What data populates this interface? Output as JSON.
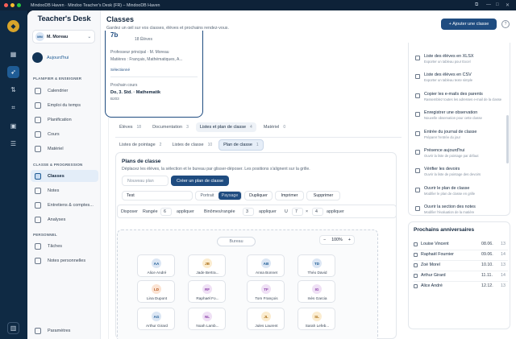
{
  "window": {
    "title": "MindooDB Haven  ·  Mindoo Teacher's Desk (FR) – MindooDB Haven"
  },
  "brand": {
    "name": "Teacher's Desk"
  },
  "user": {
    "initials": "MM",
    "name": "M. Moreau"
  },
  "sidebar": {
    "today": "Aujourd'hui",
    "section1": "PLANIFIER & ENSEIGNER",
    "plan_items": [
      "Calendrier",
      "Emploi du temps",
      "Planification",
      "Cours",
      "Matériel"
    ],
    "section2": "CLASSE & PROGRESSION",
    "class_items": [
      "Classes",
      "Notes",
      "Entretiens & comptes...",
      "Analyses"
    ],
    "section3": "PERSONNEL",
    "personal_items": [
      "Tâches",
      "Notes personnelles"
    ],
    "settings": "Paramètres"
  },
  "header": {
    "title": "Classes",
    "subtitle": "Gardez un œil sur vos classes, élèves et prochains rendez-vous.",
    "add_button": "+ Ajouter une classe",
    "help": "?"
  },
  "class_card": {
    "badge": "7b",
    "students": "18 Élèves",
    "teacher": "Professeur principal · M. Moreau",
    "subjects": "Matières : Français, Mathématiques, A...",
    "selected": "Sélectionné",
    "next_label": "Prochain cours",
    "next_value": "Do, 3. Std. · Mathematik",
    "room": "B203"
  },
  "tabs": [
    {
      "label": "Élèves",
      "count": "18"
    },
    {
      "label": "Documentation",
      "count": "3"
    },
    {
      "label": "Listes et plan de classe",
      "count": "4"
    },
    {
      "label": "Matériel",
      "count": "0"
    }
  ],
  "subtabs": [
    {
      "label": "Listes de pointage",
      "count": "2"
    },
    {
      "label": "Listes de classe",
      "count": "10"
    },
    {
      "label": "Plan de classe",
      "count": "1"
    }
  ],
  "plan": {
    "title": "Plans de classe",
    "subtitle": "Déplacez les élèves, la sélection et le bureau par glisser-déposer. Les positions s'alignent sur la grille.",
    "new_placeholder": "Nouveau plan",
    "create_button": "Créer un plan de classe",
    "name_value": "Test",
    "orientation": [
      "Portrait",
      "Paysage"
    ],
    "actions": [
      "Dupliquer",
      "Imprimer",
      "Supprimer"
    ],
    "layout": {
      "disposer": "Disposer",
      "rangee_label": "Rangée",
      "rangee_value": "6",
      "apply1": "appliquer",
      "binomes_label": "Binômes/rangée",
      "binomes_value": "3",
      "apply2": "appliquer",
      "u_label": "U",
      "u_a": "7",
      "x": "×",
      "u_b": "4",
      "apply3": "appliquer"
    },
    "bureau": "Bureau",
    "zoom": {
      "minus": "−",
      "value": "100%",
      "plus": "+"
    },
    "desks": [
      {
        "i": "AA",
        "n": "Alice André",
        "c": "#dbe6f4",
        "t": "#1f5c95"
      },
      {
        "i": "JB",
        "n": "Jade Bertra...",
        "c": "#fbeccf",
        "t": "#a86b12"
      },
      {
        "i": "AB",
        "n": "Anna Bonnet",
        "c": "#dbe6f4",
        "t": "#1f5c95"
      },
      {
        "i": "TD",
        "n": "Théo David",
        "c": "#dbe6f4",
        "t": "#1f5c95"
      },
      {
        "i": "LD",
        "n": "Lina Dupont",
        "c": "#fbe3d3",
        "t": "#b5551c"
      },
      {
        "i": "RF",
        "n": "Raphaël Fo...",
        "c": "#efe0f5",
        "t": "#8a3fa8"
      },
      {
        "i": "TF",
        "n": "Tom François",
        "c": "#efe0f5",
        "t": "#8a3fa8"
      },
      {
        "i": "IG",
        "n": "Inès Garcia",
        "c": "#efe0f5",
        "t": "#8a3fa8"
      },
      {
        "i": "AG",
        "n": "Arthur Girard",
        "c": "#dbe6f4",
        "t": "#1f5c95"
      },
      {
        "i": "NL",
        "n": "Noah Lamb...",
        "c": "#efe0f5",
        "t": "#8a3fa8"
      },
      {
        "i": "JL",
        "n": "Jules Laurent",
        "c": "#fbeccf",
        "t": "#a86b12"
      },
      {
        "i": "SL",
        "n": "Sarah Lefeb...",
        "c": "#fbeccf",
        "t": "#a86b12"
      }
    ]
  },
  "exports": [
    {
      "l": "Liste des élèves en XLSX",
      "s": "Exporter un tableau pour Excel"
    },
    {
      "l": "Liste des élèves en CSV",
      "s": "Exporter un tableau texte simple"
    },
    {
      "l": "Copier les e-mails des parents",
      "s": "Rassemblez toutes les adresses e-mail de la classe"
    },
    {
      "l": "Enregistrer une observation",
      "s": "Nouvelle observation pour cette classe"
    },
    {
      "l": "Entrée du journal de classe",
      "s": "Préparer l'entrée du jour"
    },
    {
      "l": "Présence aujourd'hui",
      "s": "Ouvrir la liste de pointage par défaut"
    },
    {
      "l": "Vérifier les devoirs",
      "s": "Ouvrir la liste de pointage des devoirs"
    },
    {
      "l": "Ouvrir le plan de classe",
      "s": "Modifier le plan de classe en grille"
    },
    {
      "l": "Ouvrir la section des notes",
      "s": "Modifier l'évaluation de la matière"
    }
  ],
  "birthdays": {
    "title": "Prochains anniversaires",
    "items": [
      {
        "n": "Louise Vincent",
        "d": "08.06.",
        "a": "13"
      },
      {
        "n": "Raphaël Fournier",
        "d": "09.06.",
        "a": "14"
      },
      {
        "n": "Zoé Morel",
        "d": "10.10.",
        "a": "13"
      },
      {
        "n": "Arthur Girard",
        "d": "11.11.",
        "a": "14"
      },
      {
        "n": "Alice André",
        "d": "12.12.",
        "a": "13"
      }
    ]
  }
}
